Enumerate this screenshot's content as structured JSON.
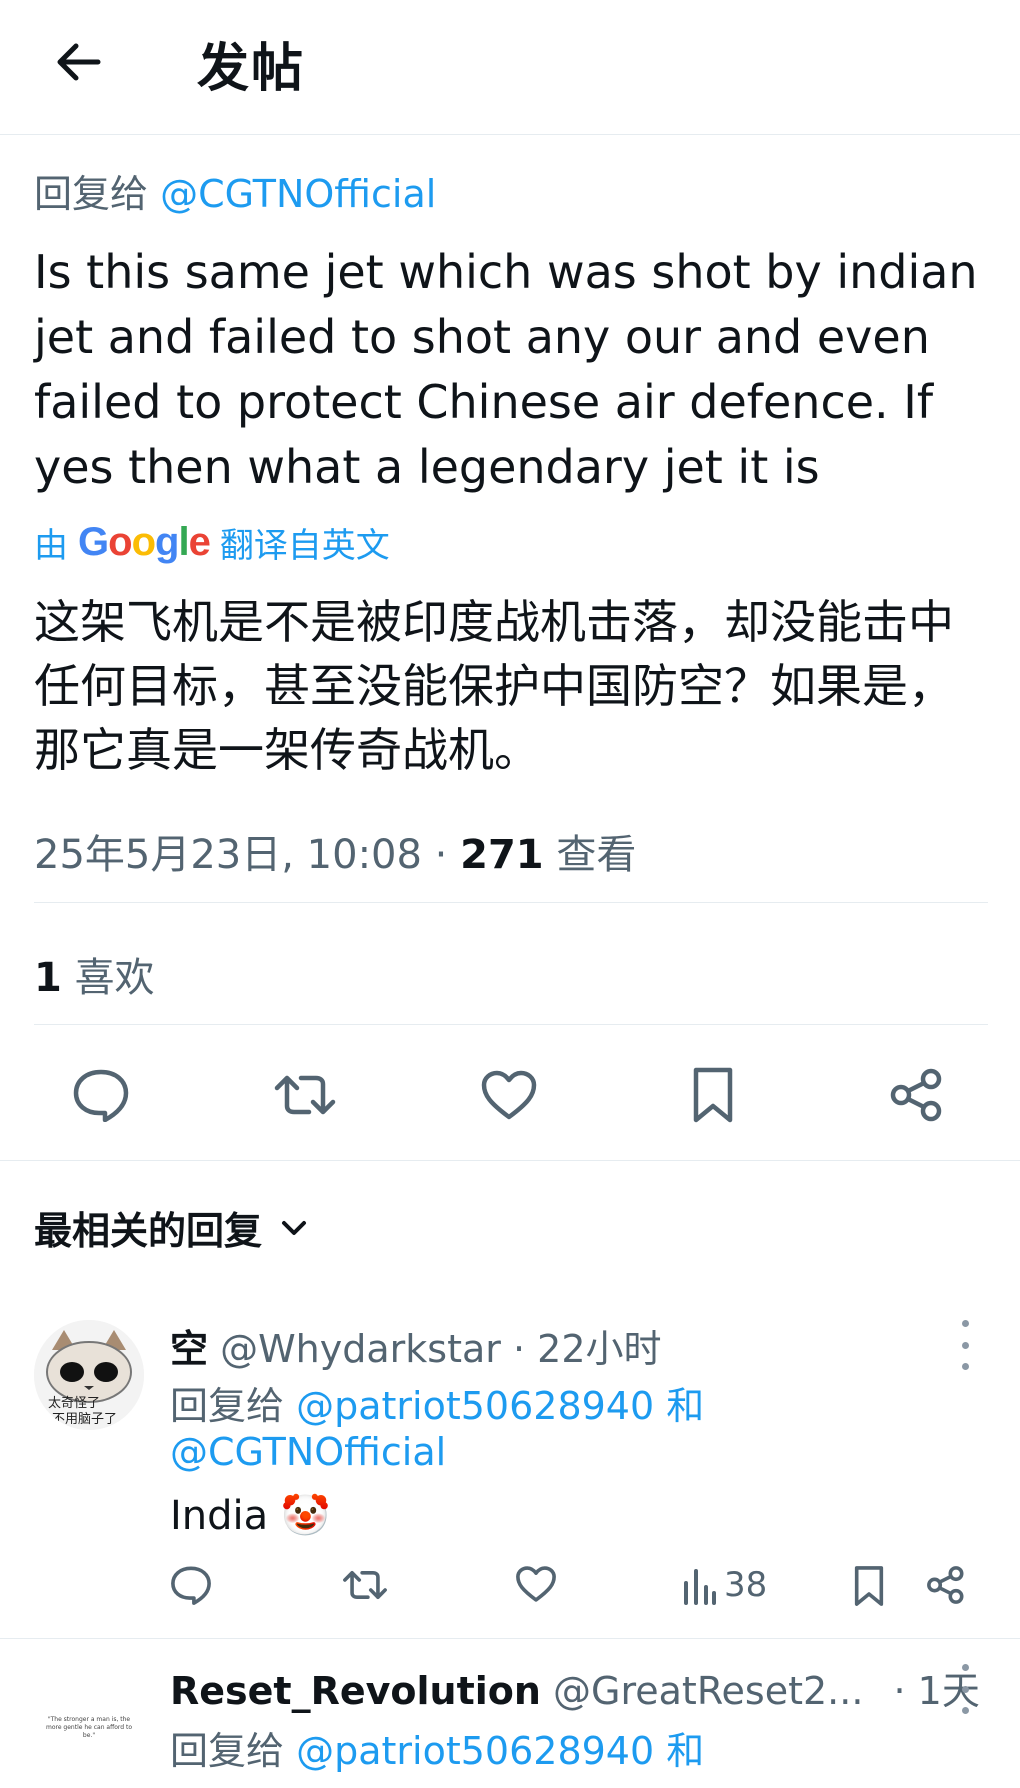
{
  "header": {
    "title": "发帖"
  },
  "post": {
    "reply_label": "回复给",
    "reply_handle": "@CGTNOfficial",
    "text": "Is this same jet which was shot by indian jet and failed to shot any our and even failed to protect Chinese air defence. If yes then what a legendary jet it is",
    "translate_by": "由",
    "translate_brand": "Google",
    "translate_suffix": "翻译自英文",
    "translated_text": "这架飞机是不是被印度战机击落，却没能击中任何目标，甚至没能保护中国防空？如果是，那它真是一架传奇战机。",
    "timestamp": "25年5月23日, 10:08",
    "dot": "·",
    "views_count": "271",
    "views_label": "查看",
    "likes_count": "1",
    "likes_label": "喜欢"
  },
  "replies_section": {
    "sort_label": "最相关的回复"
  },
  "replies": [
    {
      "name": "空",
      "handle": "@Whydarkstar",
      "time": "· 22小时",
      "reply_label": "回复给",
      "reply_handle_1": "@patriot50628940",
      "conj": "和",
      "reply_handle_2": "@CGTNOfficial",
      "text": "India 🤡",
      "views": "38",
      "avatar_text_1": "太奇怪了",
      "avatar_text_2": "不用脑子了"
    },
    {
      "name": "Reset_Revolution",
      "handle": "@GreatReset2...",
      "time": "· 1天",
      "reply_label": "回复给",
      "reply_handle_1": "@patriot50628940",
      "conj": "和",
      "avatar_text_1": "\"The stronger a man is, the more gentle he can afford to be.\""
    }
  ],
  "colors": {
    "accent": "#1d9bf0",
    "muted": "#536471",
    "text": "#0f1419",
    "divider": "#e6ecf0"
  }
}
